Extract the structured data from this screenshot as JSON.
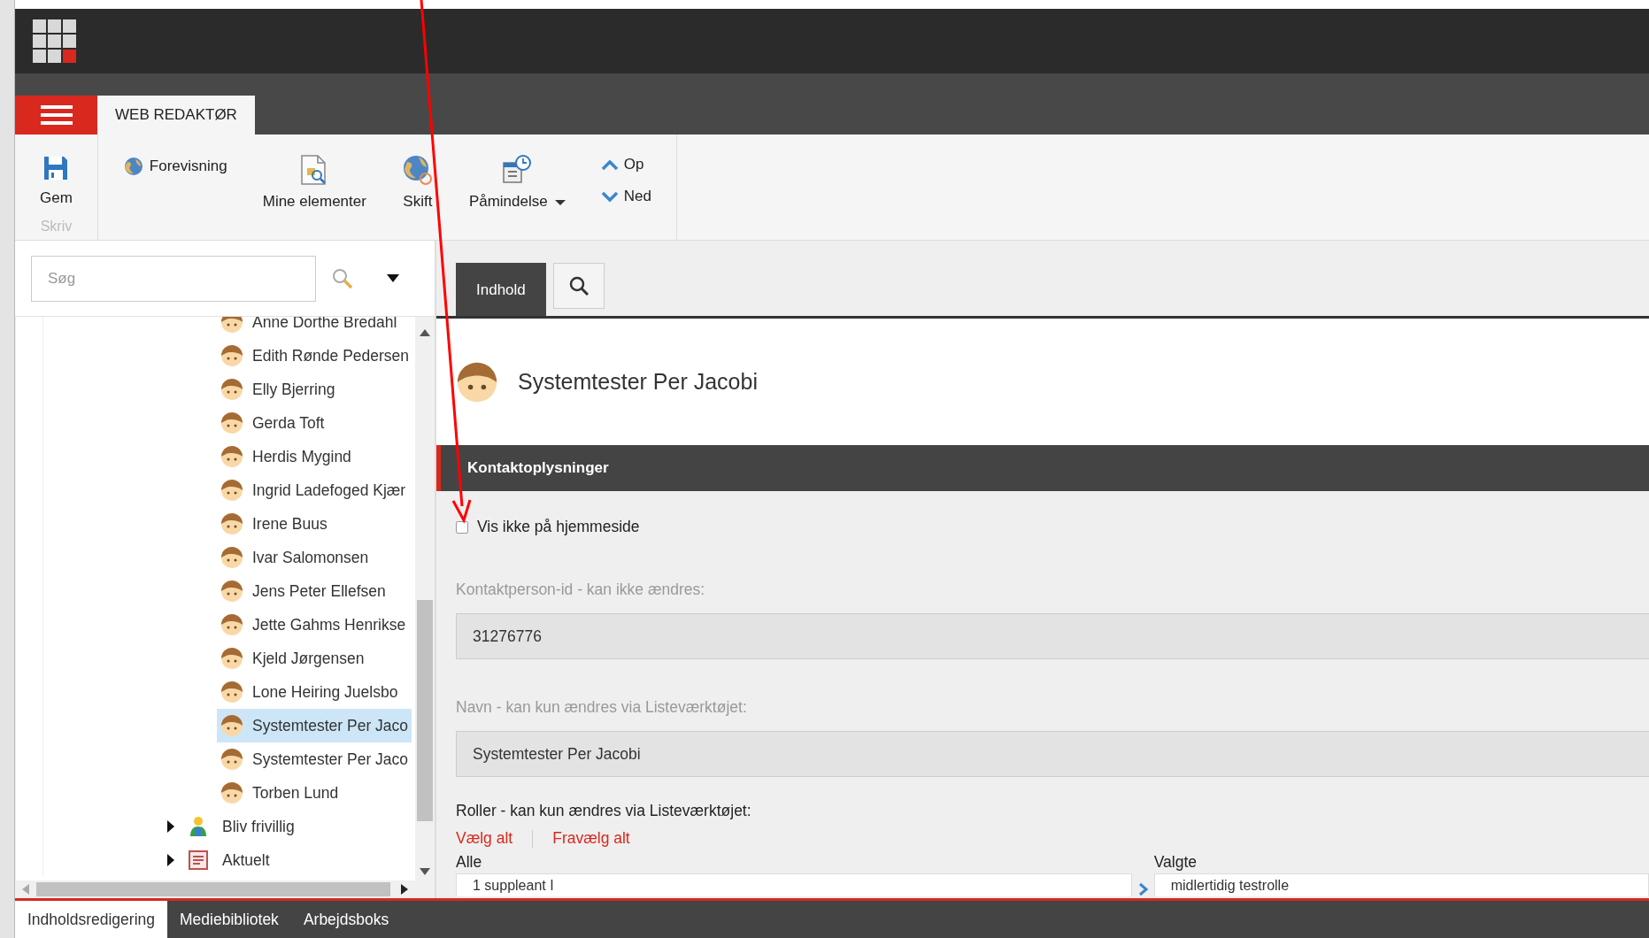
{
  "app_tabs": [
    {
      "label": "WEB REDAKTØR",
      "selected": true
    }
  ],
  "ribbon": {
    "groups": [
      {
        "label": "Skriv",
        "buttons": [
          {
            "label": "Gem",
            "kind": "large"
          }
        ]
      },
      {
        "buttons": [
          {
            "label": "Forevisning",
            "kind": "small"
          },
          {
            "label": "Mine elementer",
            "kind": "large"
          },
          {
            "label": "Skift",
            "kind": "large"
          },
          {
            "label": "Påmindelse",
            "kind": "large",
            "dropdown": true
          },
          {
            "kind": "stack",
            "items": [
              {
                "label": "Op"
              },
              {
                "label": "Ned"
              }
            ]
          }
        ]
      }
    ]
  },
  "search": {
    "placeholder": "Søg"
  },
  "tree": {
    "nodes": [
      {
        "children": [
          {
            "label": "Anne Dorthe Bredahl",
            "kind": "person",
            "selected": false
          },
          {
            "label": "Edith Rønde Pedersen",
            "kind": "person",
            "selected": false
          },
          {
            "label": "Elly Bjerring",
            "kind": "person",
            "selected": false
          },
          {
            "label": "Gerda Toft",
            "kind": "person",
            "selected": false
          },
          {
            "label": "Herdis Mygind",
            "kind": "person",
            "selected": false
          },
          {
            "label": "Ingrid Ladefoged Kjær",
            "kind": "person",
            "selected": false
          },
          {
            "label": "Irene Buus",
            "kind": "person",
            "selected": false
          },
          {
            "label": "Ivar Salomonsen",
            "kind": "person",
            "selected": false
          },
          {
            "label": "Jens Peter Ellefsen",
            "kind": "person",
            "selected": false
          },
          {
            "label": "Jette Gahms Henrikse",
            "kind": "person",
            "selected": false
          },
          {
            "label": "Kjeld Jørgensen",
            "kind": "person",
            "selected": false
          },
          {
            "label": "Lone Heiring Juelsbo",
            "kind": "person",
            "selected": false
          },
          {
            "label": "Systemtester Per Jaco",
            "kind": "person",
            "selected": true
          },
          {
            "label": "Systemtester Per Jaco",
            "kind": "person",
            "selected": false
          },
          {
            "label": "Torben Lund",
            "kind": "person",
            "selected": false
          }
        ]
      },
      {
        "label": "Bliv frivillig",
        "kind": "volunteer",
        "expanded": false,
        "selected": false
      },
      {
        "label": "Aktuelt",
        "kind": "news",
        "expanded": false,
        "selected": false
      }
    ]
  },
  "content_tabs": [
    {
      "label": "Indhold",
      "kind": "text",
      "selected": true
    },
    {
      "kind": "search",
      "selected": false
    }
  ],
  "item": {
    "title": "Systemtester Per Jacobi"
  },
  "section": {
    "title": "Kontaktoplysninger"
  },
  "hide_checkbox": {
    "label": "Vis ikke på hjemmeside",
    "checked": false
  },
  "fields": [
    {
      "label": "Kontaktperson-id - kan ikke ændres:",
      "value": "31276776",
      "disabled": true
    },
    {
      "label": "Navn - kan kun ændres via Listeværktøjet:",
      "value": "Systemtester Per Jacobi",
      "disabled": true
    }
  ],
  "roles": {
    "label": "Roller - kan kun ændres via Listeværktøjet:",
    "links": [
      "Vælg alt",
      "Fravælg alt"
    ],
    "lists": [
      {
        "label": "Alle",
        "items": [
          "1 suppleant I"
        ]
      },
      {
        "label": "Valgte",
        "items": [
          "midlertidig testrolle"
        ]
      }
    ]
  },
  "bottom_tabs": [
    {
      "label": "Indholdsredigering",
      "selected": true
    },
    {
      "label": "Mediebibliotek",
      "selected": false
    },
    {
      "label": "Arbejdsboks",
      "selected": false
    }
  ]
}
